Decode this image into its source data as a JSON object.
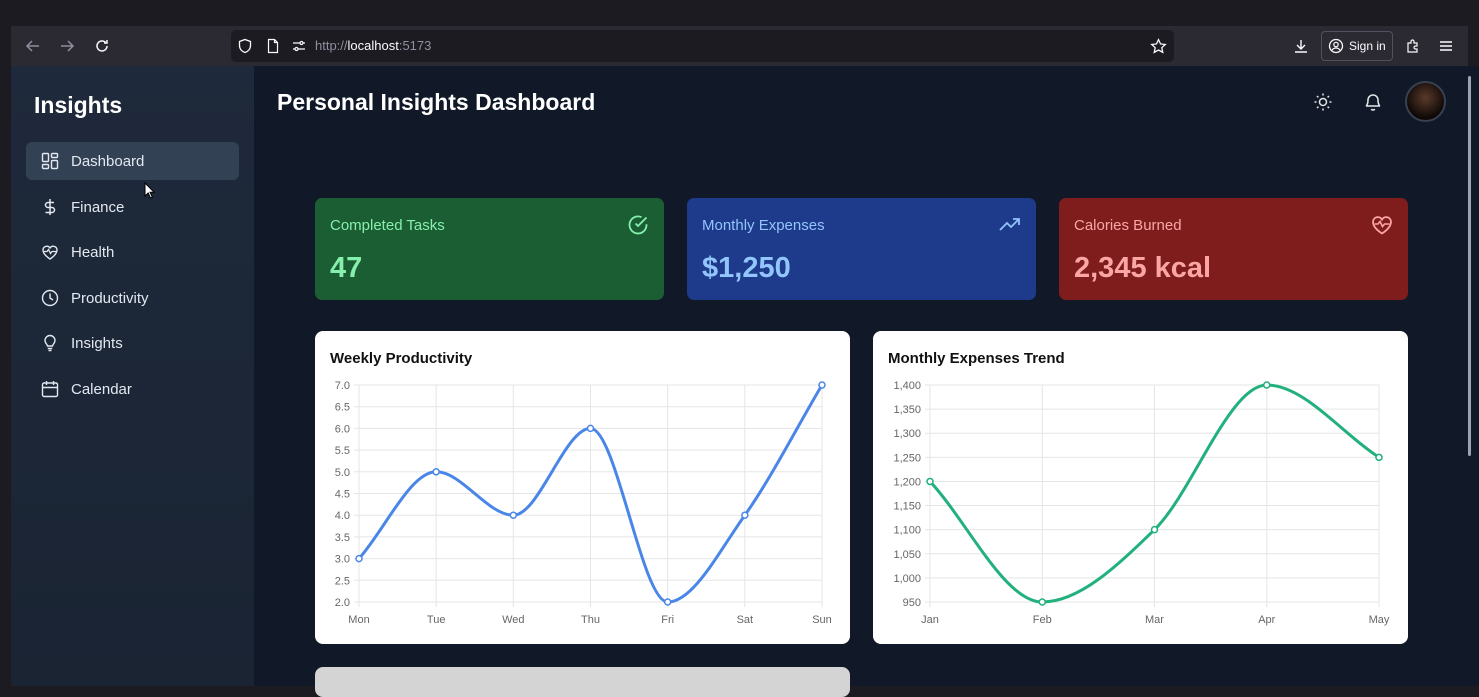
{
  "browser": {
    "url_prefix": "http://",
    "url_host": "localhost",
    "url_port": ":5173",
    "sign_in_label": "Sign in"
  },
  "sidebar": {
    "brand": "Insights",
    "items": [
      {
        "label": "Dashboard",
        "icon": "dashboard-icon",
        "active": true
      },
      {
        "label": "Finance",
        "icon": "dollar-icon",
        "active": false
      },
      {
        "label": "Health",
        "icon": "heart-pulse-icon",
        "active": false
      },
      {
        "label": "Productivity",
        "icon": "clock-icon",
        "active": false
      },
      {
        "label": "Insights",
        "icon": "lightbulb-icon",
        "active": false
      },
      {
        "label": "Calendar",
        "icon": "calendar-icon",
        "active": false
      }
    ]
  },
  "header": {
    "title": "Personal Insights Dashboard",
    "icons": [
      "sun-icon",
      "bell-icon",
      "avatar"
    ]
  },
  "stats": [
    {
      "title": "Completed Tasks",
      "value": "47",
      "icon": "check-circle-icon",
      "color": "#1b5e34"
    },
    {
      "title": "Monthly Expenses",
      "value": "$1,250",
      "icon": "trending-up-icon",
      "color": "#1e3a8a"
    },
    {
      "title": "Calories Burned",
      "value": "2,345 kcal",
      "icon": "heart-pulse-icon",
      "color": "#7f1d1d"
    }
  ],
  "chart_data": [
    {
      "type": "line",
      "title": "Weekly Productivity",
      "categories": [
        "Mon",
        "Tue",
        "Wed",
        "Thu",
        "Fri",
        "Sat",
        "Sun"
      ],
      "series": [
        {
          "values": [
            3,
            5,
            4,
            6,
            2,
            4,
            7
          ],
          "color": "#4a86e8"
        }
      ],
      "ylim": [
        2,
        7
      ],
      "yticks": [
        "2.0",
        "2.5",
        "3.0",
        "3.5",
        "4.0",
        "4.5",
        "5.0",
        "5.5",
        "6.0",
        "6.5",
        "7.0"
      ],
      "grid": true
    },
    {
      "type": "line",
      "title": "Monthly Expenses Trend",
      "categories": [
        "Jan",
        "Feb",
        "Mar",
        "Apr",
        "May"
      ],
      "series": [
        {
          "values": [
            1200,
            950,
            1100,
            1400,
            1250
          ],
          "color": "#22b07d"
        }
      ],
      "ylim": [
        950,
        1400
      ],
      "yticks": [
        "950",
        "1,000",
        "1,050",
        "1,100",
        "1,150",
        "1,200",
        "1,250",
        "1,300",
        "1,350",
        "1,400"
      ],
      "grid": true
    }
  ]
}
